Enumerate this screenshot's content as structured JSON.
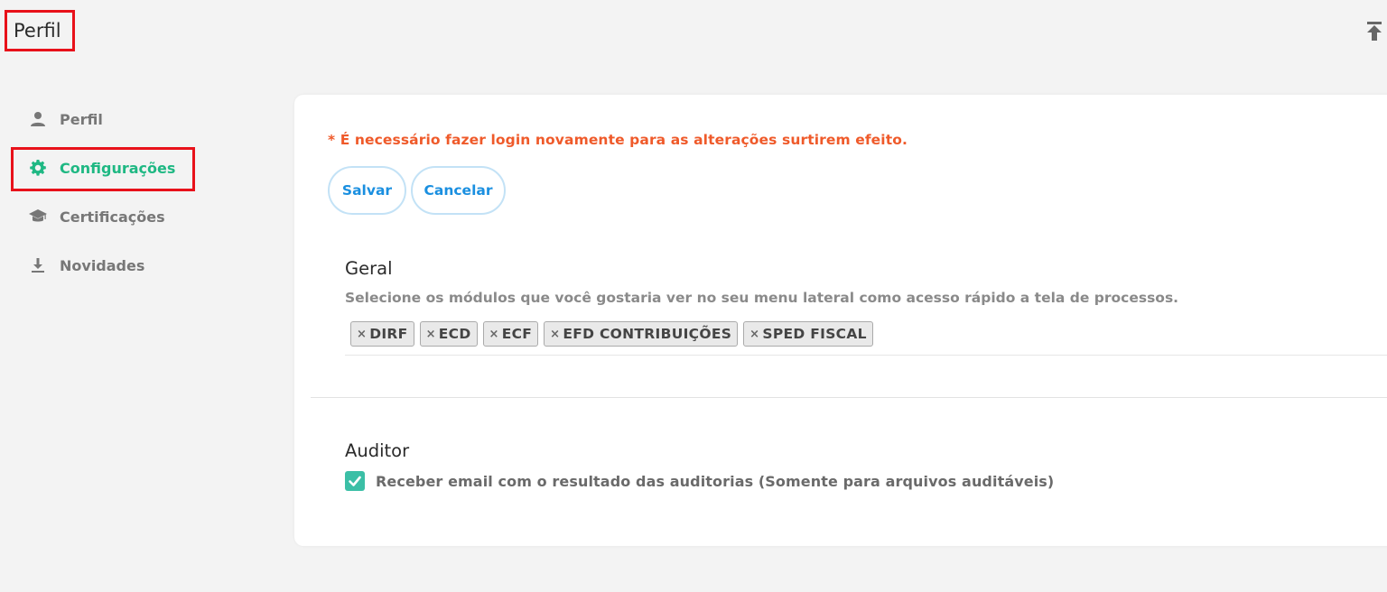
{
  "header": {
    "title": "Perfil",
    "scroll_top_icon": "arrow-to-top-icon"
  },
  "sidebar": {
    "items": [
      {
        "label": "Perfil",
        "icon": "user-icon",
        "active": false
      },
      {
        "label": "Configurações",
        "icon": "gear-icon",
        "active": true
      },
      {
        "label": "Certificações",
        "icon": "graduation-cap-icon",
        "active": false
      },
      {
        "label": "Novidades",
        "icon": "download-icon",
        "active": false
      }
    ]
  },
  "main": {
    "warning": "* É necessário fazer login novamente para as alterações surtirem efeito.",
    "buttons": {
      "save": "Salvar",
      "cancel": "Cancelar"
    },
    "geral": {
      "title": "Geral",
      "description": "Selecione os módulos que você gostaria ver no seu menu lateral como acesso rápido a tela de processos.",
      "remove_symbol": "×",
      "tags": [
        "DIRF",
        "ECD",
        "ECF",
        "EFD CONTRIBUIÇÕES",
        "SPED FISCAL"
      ]
    },
    "auditor": {
      "title": "Auditor",
      "checkbox_label": "Receber email com o resultado das auditorias (Somente para arquivos auditáveis)",
      "checked": true
    }
  },
  "colors": {
    "accent": "#1fb883",
    "warning": "#ef5a2a",
    "button_text": "#1a8fe0",
    "checkbox": "#3bbfa6",
    "highlight_box": "#e8111a"
  }
}
